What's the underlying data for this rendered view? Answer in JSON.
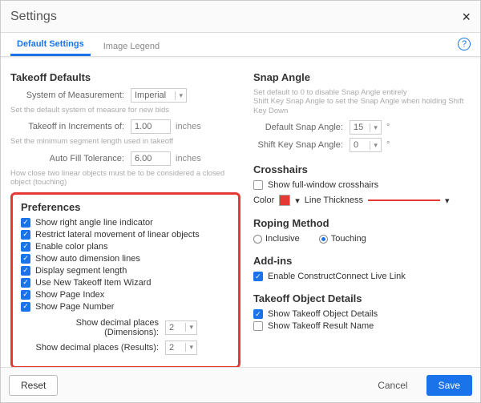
{
  "dialog": {
    "title": "Settings"
  },
  "tabs": {
    "default": "Default Settings",
    "legend": "Image Legend"
  },
  "takeoff": {
    "heading": "Takeoff Defaults",
    "systemLabel": "System of Measurement:",
    "systemValue": "Imperial",
    "systemHint": "Set the default system of measure for new bids",
    "incrLabel": "Takeoff in Increments of:",
    "incrValue": "1.00",
    "incrUnit": "inches",
    "incrHint": "Set the minimum segment length used in takeoff",
    "autofillLabel": "Auto Fill Tolerance:",
    "autofillValue": "6.00",
    "autofillUnit": "inches",
    "autofillHint": "How close two linear objects must be to be considered a closed object (touching)"
  },
  "prefs": {
    "heading": "Preferences",
    "items": [
      "Show right angle line indicator",
      "Restrict lateral movement of linear objects",
      "Enable color plans",
      "Show auto dimension lines",
      "Display segment length",
      "Use New Takeoff Item Wizard",
      "Show Page Index",
      "Show Page Number"
    ],
    "decDimLabel": "Show decimal places (Dimensions):",
    "decDimValue": "2",
    "decResLabel": "Show decimal places (Results):",
    "decResValue": "2"
  },
  "snap": {
    "heading": "Snap Angle",
    "hint": "Set default to 0 to disable Snap Angle entirely\nShift Key Snap Angle to set the Snap Angle when holding Shift Key Down",
    "defLabel": "Default Snap Angle:",
    "defValue": "15",
    "shiftLabel": "Shift Key Snap Angle:",
    "shiftValue": "0",
    "degree": "°"
  },
  "cross": {
    "heading": "Crosshairs",
    "fullLabel": "Show full-window crosshairs",
    "colorLabel": "Color",
    "colorValue": "#e53935",
    "thickLabel": "Line Thickness"
  },
  "roping": {
    "heading": "Roping Method",
    "inclusive": "Inclusive",
    "touching": "Touching"
  },
  "addins": {
    "heading": "Add-ins",
    "liveLink": "Enable ConstructConnect Live Link"
  },
  "details": {
    "heading": "Takeoff Object Details",
    "showDetails": "Show Takeoff Object Details",
    "showResultName": "Show Takeoff Result Name"
  },
  "footer": {
    "reset": "Reset",
    "cancel": "Cancel",
    "save": "Save"
  }
}
